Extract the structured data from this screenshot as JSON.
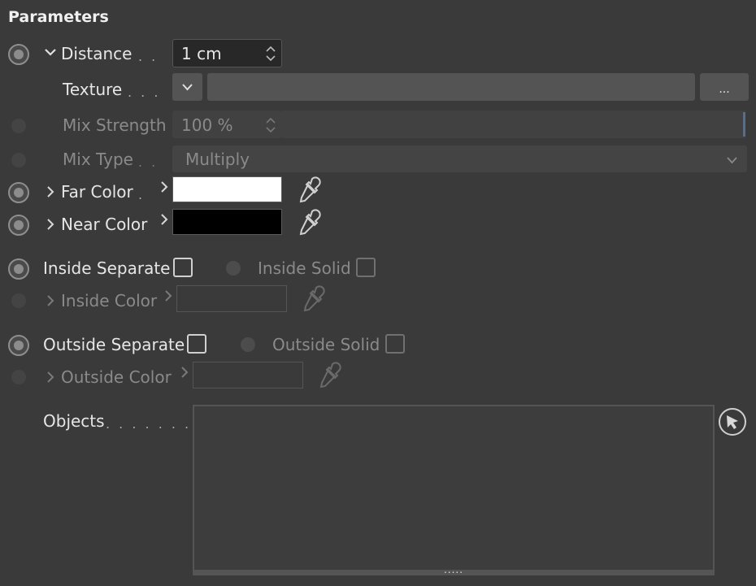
{
  "panel": {
    "title": "Parameters"
  },
  "distance": {
    "label": "Distance",
    "dots": ". .",
    "value": "1 cm"
  },
  "texture": {
    "label": "Texture",
    "dots": ". . .",
    "browse_label": "..."
  },
  "mix_strength": {
    "label": "Mix Strength",
    "value": "100 %"
  },
  "mix_type": {
    "label": "Mix Type",
    "dots": ". .",
    "value": "Multiply"
  },
  "far_color": {
    "label": "Far Color",
    "dots": ".",
    "color": "#ffffff"
  },
  "near_color": {
    "label": "Near Color",
    "color": "#000000"
  },
  "inside_separate": {
    "label": "Inside Separate",
    "checked": false
  },
  "inside_solid": {
    "label": "Inside Solid",
    "checked": false
  },
  "inside_color": {
    "label": "Inside Color"
  },
  "outside_separate": {
    "label": "Outside Separate",
    "checked": false
  },
  "outside_solid": {
    "label": "Outside Solid",
    "checked": false
  },
  "outside_color": {
    "label": "Outside Color"
  },
  "objects": {
    "label": "Objects",
    "dots": ". . . . . . .",
    "resize_grip": "....."
  },
  "icons": {
    "eyedropper": "eyedropper-icon",
    "chevron": "chevron-icon",
    "picker": "pick-object-icon"
  }
}
